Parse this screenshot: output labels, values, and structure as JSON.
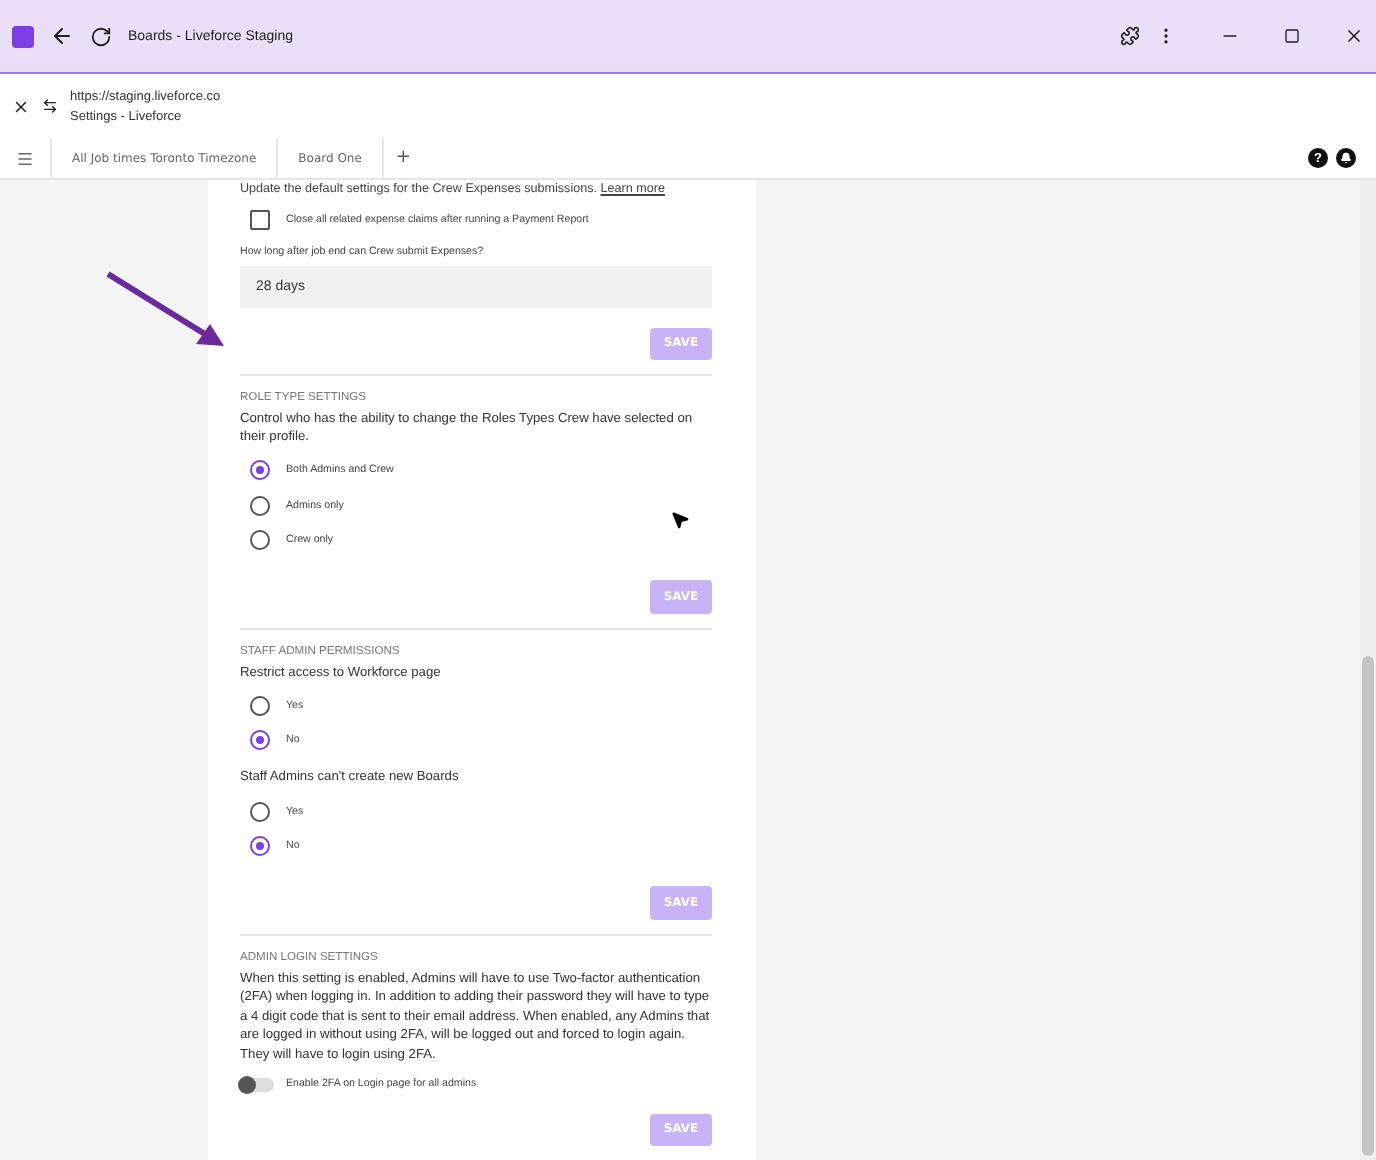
{
  "window": {
    "title": "Boards - Liveforce Staging",
    "url": "https://staging.liveforce.co",
    "page_title": "Settings - Liveforce"
  },
  "tabs": [
    {
      "label": "All Job times Toronto Timezone",
      "selected": false
    },
    {
      "label": "Board One",
      "selected": false
    }
  ],
  "add_tab": "+",
  "help_badge": "?",
  "expenses": {
    "intro": "Update the default settings for the Crew Expenses submissions.",
    "link": "Learn more",
    "checkbox": {
      "label": "Close all related expense claims after running a Payment Report",
      "checked": false
    },
    "field_label": "How long after job end can Crew submit Expenses?",
    "field_value": "28 days",
    "save": "SAVE"
  },
  "sections": [
    {
      "kind": "radios",
      "heading": "ROLE TYPE SETTINGS",
      "groups": [
        {
          "question": "Control who has the ability to change the Roles Types Crew have selected on their profile.",
          "options": [
            {
              "label": "Both Admins and Crew",
              "selected": true
            },
            {
              "label": "Admins only",
              "selected": false
            },
            {
              "label": "Crew only",
              "selected": false
            }
          ]
        }
      ],
      "save": "SAVE"
    },
    {
      "kind": "radios",
      "heading": "STAFF ADMIN PERMISSIONS",
      "groups": [
        {
          "question": "Restrict access to Workforce page",
          "options": [
            {
              "label": "Yes",
              "selected": false
            },
            {
              "label": "No",
              "selected": true
            }
          ]
        },
        {
          "question": "Staff Admins can't create new Boards",
          "options": [
            {
              "label": "Yes",
              "selected": false
            },
            {
              "label": "No",
              "selected": true
            }
          ]
        }
      ],
      "save": "SAVE"
    },
    {
      "kind": "toggle",
      "heading": "ADMIN LOGIN SETTINGS",
      "text": "When this setting is enabled, Admins will have to use Two-factor authentication (2FA) when logging in. In addition to adding their password they will have to type a 4 digit code that is sent to their email address. When enabled, any Admins that are logged in without using 2FA, will be logged out and forced to login again. They will have to login using 2FA.",
      "toggle": {
        "label": "Enable 2FA on Login page for all admins",
        "on": false
      },
      "save": "SAVE"
    }
  ]
}
